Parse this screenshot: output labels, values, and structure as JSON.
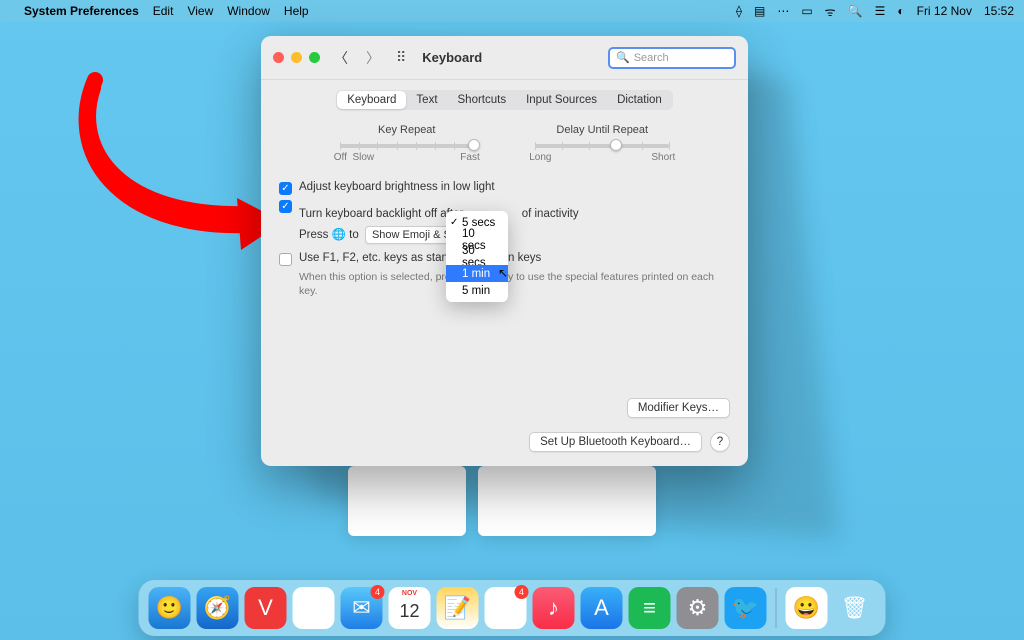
{
  "menubar": {
    "app_name": "System Preferences",
    "menus": [
      "Edit",
      "View",
      "Window",
      "Help"
    ],
    "date": "Fri 12 Nov",
    "time": "15:52"
  },
  "window": {
    "title": "Keyboard",
    "search_placeholder": "Search",
    "tabs": [
      "Keyboard",
      "Text",
      "Shortcuts",
      "Input Sources",
      "Dictation"
    ],
    "active_tab": 0,
    "sliders": {
      "key_repeat": {
        "label": "Key Repeat",
        "left": "Off",
        "left2": "Slow",
        "right": "Fast"
      },
      "delay": {
        "label": "Delay Until Repeat",
        "left": "Long",
        "right": "Short"
      }
    },
    "options": {
      "adjust_brightness": "Adjust keyboard brightness in low light",
      "backlight_off_pre": "Turn keyboard backlight off after",
      "backlight_off_post": "of inactivity",
      "press_globe_pre": "Press",
      "press_globe_post": "to",
      "press_globe_value": "Show Emoji & Symbols",
      "fn_keys": "Use F1, F2, etc. keys as standard function keys",
      "fn_help": "When this option is selected, press the Fn key to use the special features printed on each key."
    },
    "popup": {
      "options": [
        "5 secs",
        "10 secs",
        "30 secs",
        "1 min",
        "5 min"
      ],
      "checked": 0,
      "highlighted": 3
    },
    "buttons": {
      "modifier": "Modifier Keys…",
      "bluetooth": "Set Up Bluetooth Keyboard…",
      "help": "?"
    }
  },
  "dock": {
    "items": [
      {
        "name": "finder",
        "bg": "linear-gradient(180deg,#4bb3f7,#1977d3)",
        "glyph": "🙂"
      },
      {
        "name": "safari",
        "bg": "linear-gradient(180deg,#35a4f3,#1466c9)",
        "glyph": "🧭"
      },
      {
        "name": "vivaldi",
        "bg": "#ef3939",
        "glyph": "V"
      },
      {
        "name": "slack",
        "bg": "#fff",
        "glyph": "✱"
      },
      {
        "name": "mail",
        "bg": "linear-gradient(180deg,#5ac8fa,#1e7ee6)",
        "glyph": "✉︎",
        "badge": "4"
      },
      {
        "name": "calendar",
        "bg": "#fff",
        "glyph": "12",
        "text": "#e63b30",
        "top": "NOV"
      },
      {
        "name": "notes",
        "bg": "linear-gradient(180deg,#ffd55a,#fff)",
        "glyph": "📝"
      },
      {
        "name": "reminders",
        "bg": "#fff",
        "glyph": "⦿",
        "badge": "4"
      },
      {
        "name": "music",
        "bg": "linear-gradient(180deg,#fb5b74,#fa2d48)",
        "glyph": "♪"
      },
      {
        "name": "appstore",
        "bg": "linear-gradient(180deg,#39b0f8,#1a75e8)",
        "glyph": "A"
      },
      {
        "name": "spotify",
        "bg": "#1db954",
        "glyph": "≡"
      },
      {
        "name": "settings",
        "bg": "#8e8e93",
        "glyph": "⚙︎"
      },
      {
        "name": "twitter",
        "bg": "#1da1f2",
        "glyph": "🐦"
      }
    ],
    "right": [
      {
        "name": "emoji-panel",
        "bg": "#fff",
        "glyph": "😀"
      },
      {
        "name": "trash",
        "bg": "transparent",
        "glyph": "🗑"
      }
    ]
  }
}
